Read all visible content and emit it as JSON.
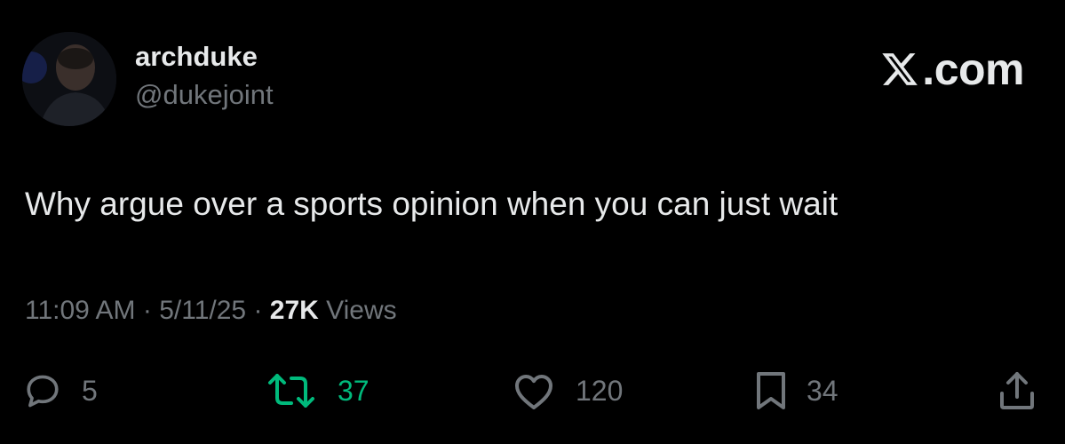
{
  "author": {
    "display_name": "archduke",
    "handle": "@dukejoint"
  },
  "brand": {
    "suffix": ".com"
  },
  "tweet": {
    "text": "Why argue over a sports opinion when you can just wait",
    "time": "11:09 AM",
    "date": "5/11/25",
    "views_count": "27K",
    "views_label": "Views",
    "separator": "·"
  },
  "actions": {
    "replies": "5",
    "reposts": "37",
    "likes": "120",
    "bookmarks": "34"
  },
  "icons": {
    "reply": "reply-icon",
    "repost": "repost-icon",
    "like": "heart-icon",
    "bookmark": "bookmark-icon",
    "share": "share-icon"
  },
  "colors": {
    "background": "#000000",
    "text_primary": "#e7e9ea",
    "text_secondary": "#71767b",
    "repost_active": "#00ba7c"
  }
}
